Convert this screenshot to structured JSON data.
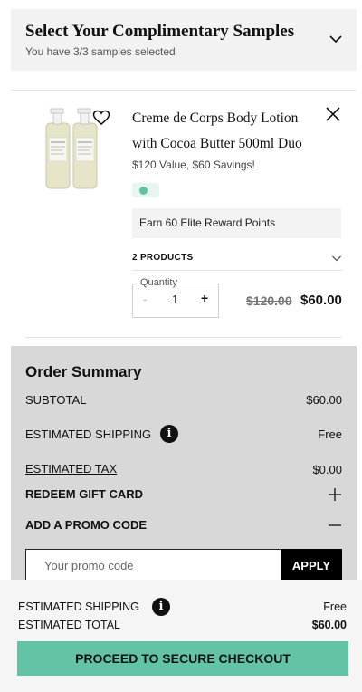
{
  "samples": {
    "title": "Select Your Complimentary Samples",
    "subtitle": "You have 3/3 samples selected",
    "toggle_icon": "chevron-down-icon"
  },
  "product": {
    "name": "Creme de Corps Body Lotion with Cocoa Butter 500ml Duo",
    "value_text": "$120 Value, $60 Savings!",
    "swatch_color": "#5cc3a6",
    "rewards_text": "Earn 60 Elite Reward Points",
    "products_label": "2 PRODUCTS",
    "quantity_label": "Quantity",
    "quantity_minus": "-",
    "quantity_value": "1",
    "quantity_plus": "+",
    "price_original": "$120.00",
    "price_sale": "$60.00",
    "icons": [
      "heart-icon",
      "close-icon",
      "chevron-down-icon"
    ]
  },
  "summary": {
    "title": "Order Summary",
    "subtotal_label": "SUBTOTAL",
    "subtotal_value": "$60.00",
    "shipping_label": "ESTIMATED SHIPPING",
    "shipping_value": "Free",
    "tax_label": "ESTIMATED TAX",
    "tax_value": "$0.00",
    "gift_card_label": "REDEEM GIFT CARD",
    "promo_label": "ADD A PROMO CODE",
    "promo_placeholder": "Your promo code",
    "apply_label": "APPLY",
    "info_glyph": "i"
  },
  "footer": {
    "shipping_label": "ESTIMATED SHIPPING",
    "shipping_value": "Free",
    "total_label": "ESTIMATED TOTAL",
    "total_value": "$60.00",
    "checkout_label": "PROCEED TO SECURE CHECKOUT",
    "checkout_color": "#62c3a6"
  }
}
